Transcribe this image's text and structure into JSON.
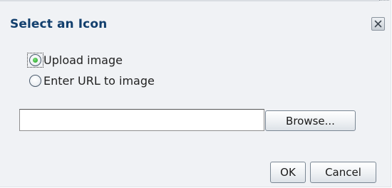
{
  "dialog": {
    "title": "Select an Icon",
    "close_icon": "close-x-icon"
  },
  "source_options": [
    {
      "label": "Upload image",
      "checked": true
    },
    {
      "label": "Enter URL to image",
      "checked": false
    }
  ],
  "file_input": {
    "value": ""
  },
  "buttons": {
    "browse_label": "Browse...",
    "ok_label": "OK",
    "cancel_label": "Cancel"
  },
  "colors": {
    "title": "#123f6d",
    "dialog_background": "#f0f2f5",
    "selected_radio": "#1e9b1e"
  }
}
